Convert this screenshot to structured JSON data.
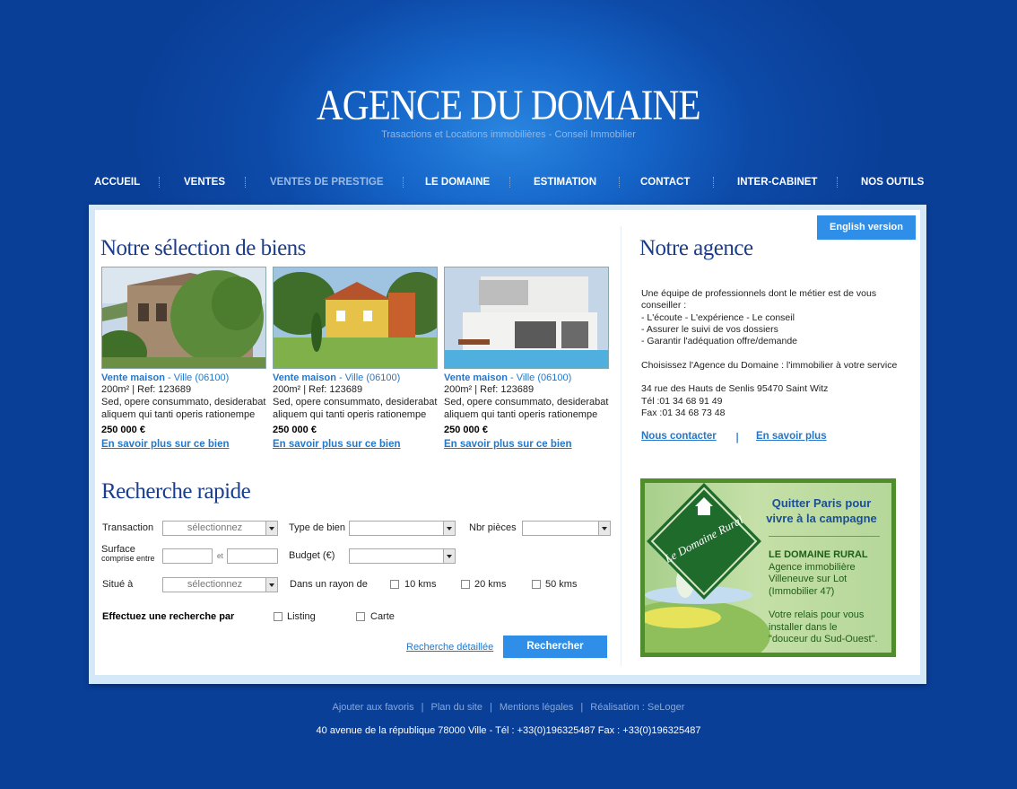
{
  "header": {
    "title": "AGENCE DU DOMAINE",
    "subtitle": "Trasactions et Locations immobilières - Conseil Immobilier"
  },
  "nav": {
    "items": [
      {
        "label": "ACCUEIL"
      },
      {
        "label": "VENTES"
      },
      {
        "label": "VENTES DE PRESTIGE"
      },
      {
        "label": "LE DOMAINE"
      },
      {
        "label": "ESTIMATION"
      },
      {
        "label": "CONTACT"
      },
      {
        "label": "INTER-CABINET"
      },
      {
        "label": "NOS OUTILS"
      }
    ],
    "active": "VENTES DE PRESTIGE"
  },
  "english_button": "English version",
  "selection": {
    "title": "Notre sélection de biens",
    "cards": [
      {
        "type": "Vente maison",
        "location": " - Ville (06100)",
        "specs": "200m² | Ref: 123689",
        "desc1": "Sed, opere consummato, desiderabat",
        "desc2": "aliquem qui tanti operis rationempe",
        "price": "250 000 €",
        "link": "En savoir plus sur ce bien",
        "photo": "stone-house-ivy-photo"
      },
      {
        "type": "Vente maison",
        "location": " - Ville (06100)",
        "specs": "200m² | Ref: 123689",
        "desc1": "Sed, opere consummato, desiderabat",
        "desc2": "aliquem qui tanti operis rationempe",
        "price": "250 000 €",
        "link": "En savoir plus sur ce bien",
        "photo": "yellow-house-garden-photo"
      },
      {
        "type": "Vente maison",
        "location": " - Ville (06100)",
        "specs": "200m² | Ref: 123689",
        "desc1": "Sed, opere consummato, desiderabat",
        "desc2": "aliquem qui tanti operis rationempe",
        "price": "250 000 €",
        "link": "En savoir plus sur ce bien",
        "photo": "modern-villa-pool-photo"
      }
    ]
  },
  "search": {
    "title": "Recherche rapide",
    "transaction_label": "Transaction",
    "transaction_value": "sélectionnez",
    "type_label": "Type de bien",
    "type_value": "",
    "rooms_label": "Nbr pièces",
    "rooms_value": "",
    "surface_label": "Surface",
    "surface_sub": "comprise entre",
    "surface_and": "et",
    "budget_label": "Budget (€)",
    "budget_value": "",
    "location_label": "Situé à",
    "location_value": "sélectionnez",
    "radius_label": "Dans un rayon de",
    "radius_options": [
      "10 kms",
      "20 kms",
      "50 kms"
    ],
    "mode_label": "Effectuez une recherche par",
    "mode_options": [
      "Listing",
      "Carte"
    ],
    "detail_link": "Recherche détaillée",
    "submit": "Rechercher"
  },
  "agency": {
    "title": "Notre agence",
    "line1": "Une équipe de professionnels dont le métier est de vous",
    "line2": "conseiller :",
    "line3": "- L'écoute - L'expérience - Le conseil",
    "line4": "- Assurer le suivi de vos dossiers",
    "line5": "- Garantir l'adéquation offre/demande",
    "tagline": "Choisissez l'Agence du Domaine : l'immobilier à votre service",
    "address": "34 rue des Hauts de Senlis 95470 Saint Witz",
    "tel": "Tél :01 34 68 91 49",
    "fax": "Fax :01 34 68 73 48",
    "contact_link": "Nous contacter",
    "separator": "|",
    "more_link": "En savoir plus"
  },
  "banner": {
    "logo_text": "Le Domaine Rural",
    "title1": "Quitter Paris pour",
    "title2": "vivre à la campagne",
    "name": "LE DOMAINE RURAL",
    "line1": "Agence immobilière",
    "line2": "Villeneuve sur Lot",
    "line3": "(Immobilier 47)",
    "line4": "Votre relais pour vous",
    "line5": " installer dans le",
    "line6": "\"douceur du Sud-Ouest\"."
  },
  "footer": {
    "links": [
      "Ajouter aux favoris",
      "Plan du site",
      "Mentions légales",
      "Réalisation : SeLoger"
    ],
    "separator": "|",
    "address": "40 avenue de la république  78000 Ville   -   Tél : +33(0)196325487 Fax : +33(0)196325487"
  },
  "colors": {
    "background": "#0d4aa8",
    "accent": "#2f8fe8",
    "heading": "#1a3d8c",
    "link": "#2577c9"
  }
}
